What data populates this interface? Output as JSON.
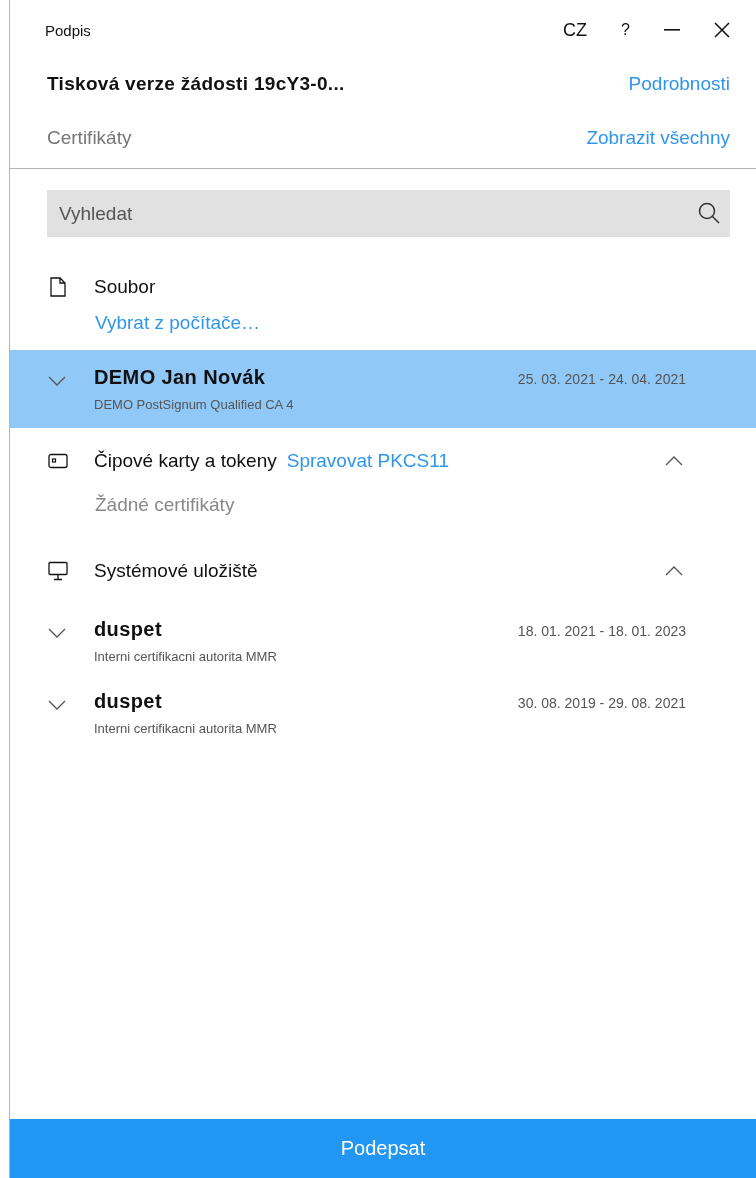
{
  "window": {
    "title": "Podpis",
    "language": "CZ",
    "help": "?"
  },
  "document": {
    "title": "Tisková verze žádosti 19cY3-0...",
    "details_link": "Podrobnosti"
  },
  "certificates_header": {
    "label": "Certifikáty",
    "show_all_link": "Zobrazit všechny"
  },
  "search": {
    "placeholder": "Vyhledat"
  },
  "file_section": {
    "label": "Soubor",
    "link": "Vybrat z počítače…"
  },
  "file_certificates": [
    {
      "name": "DEMO Jan Novák",
      "issuer": "DEMO PostSignum Qualified CA 4",
      "validity": "25. 03. 2021 - 24. 04. 2021",
      "selected": true,
      "expanded": false
    }
  ],
  "sections": [
    {
      "kind": "smartcard",
      "label": "Čipové karty a tokeny",
      "link": "Spravovat PKCS11",
      "expanded": true,
      "empty_text": "Žádné certifikáty"
    },
    {
      "kind": "system",
      "label": "Systémové uložiště",
      "expanded": true,
      "certificates": [
        {
          "name": "duspet",
          "issuer": "Interni certifikacni autorita MMR",
          "validity": "18. 01. 2021 - 18. 01. 2023",
          "selected": false,
          "expanded": false
        },
        {
          "name": "duspet",
          "issuer": "Interni certifikacni autorita MMR",
          "validity": "30. 08. 2019 - 29. 08. 2021",
          "selected": false,
          "expanded": false
        }
      ]
    }
  ],
  "sign_button": "Podepsat"
}
